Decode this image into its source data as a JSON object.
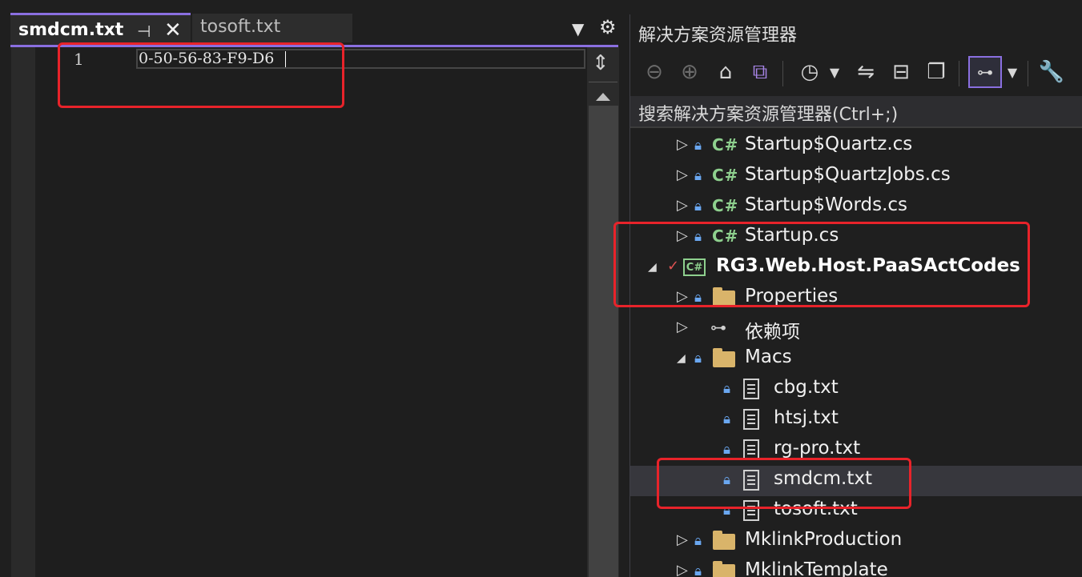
{
  "editor": {
    "tabs": [
      {
        "label": "smdcm.txt",
        "active": true
      },
      {
        "label": "tosoft.txt",
        "active": false
      }
    ],
    "lines": [
      {
        "number": "1",
        "text": "0-50-56-83-F9-D6"
      }
    ]
  },
  "explorer": {
    "title": "解决方案资源管理器",
    "search_placeholder": "搜索解决方案资源管理器(Ctrl+;)",
    "items": [
      {
        "label": "Startup$Quartz.cs",
        "type": "csharp"
      },
      {
        "label": "Startup$QuartzJobs.cs",
        "type": "csharp"
      },
      {
        "label": "Startup$Words.cs",
        "type": "csharp"
      },
      {
        "label": "Startup.cs",
        "type": "csharp"
      },
      {
        "label": "RG3.Web.Host.PaaSActCodes",
        "type": "project"
      },
      {
        "label": "Properties",
        "type": "folder"
      },
      {
        "label": "依赖项",
        "type": "dependencies"
      },
      {
        "label": "Macs",
        "type": "folder"
      },
      {
        "label": "cbg.txt",
        "type": "file"
      },
      {
        "label": "htsj.txt",
        "type": "file"
      },
      {
        "label": "rg-pro.txt",
        "type": "file"
      },
      {
        "label": "smdcm.txt",
        "type": "file",
        "selected": true
      },
      {
        "label": "tosoft.txt",
        "type": "file"
      },
      {
        "label": "MklinkProduction",
        "type": "folder"
      },
      {
        "label": "MklinkTemplate",
        "type": "folder"
      }
    ]
  },
  "colors": {
    "accent": "#8a6fe0",
    "highlight": "#e8232a",
    "csharp": "#8ed08e",
    "lock": "#6aa7f0",
    "folder": "#d9b46a"
  }
}
